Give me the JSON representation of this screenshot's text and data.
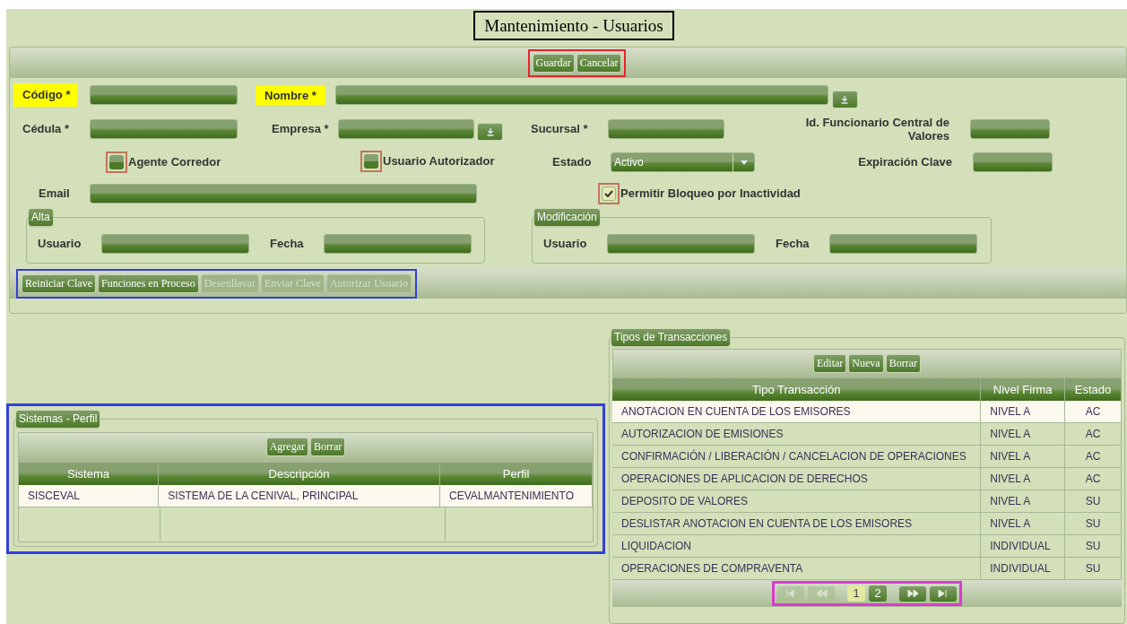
{
  "title": "Mantenimiento - Usuarios",
  "top_buttons": [
    {
      "label": "Guardar",
      "disabled": false
    },
    {
      "label": "Cancelar",
      "disabled": false
    }
  ],
  "fields": {
    "codigo": {
      "label": "Código *",
      "highlighted": true
    },
    "nombre": {
      "label": "Nombre *",
      "highlighted": true
    },
    "cedula": {
      "label": "Cédula *",
      "highlighted": false
    },
    "empresa": {
      "label": "Empresa *",
      "highlighted": false
    },
    "sucursal": {
      "label": "Sucursal *",
      "highlighted": false
    },
    "id_funcionario": {
      "label": "Id. Funcionario Central de Valores",
      "highlighted": false
    },
    "estado": {
      "label": "Estado",
      "value": "Activo",
      "highlighted": false
    },
    "expiracion": {
      "label": "Expiración Clave",
      "highlighted": false
    },
    "email": {
      "label": "Email",
      "highlighted": false
    }
  },
  "checkboxes": [
    {
      "label": "Agente Corredor",
      "checked": false
    },
    {
      "label": "Usuario Autorizador",
      "checked": false
    },
    {
      "label": "Permitir Bloqueo por Inactividad",
      "checked": true
    }
  ],
  "alta": {
    "legend": "Alta",
    "labels": [
      "Usuario",
      "Fecha"
    ]
  },
  "modificacion": {
    "legend": "Modificación",
    "labels": [
      "Usuario",
      "Fecha"
    ]
  },
  "action_buttons": [
    {
      "label": "Reiniciar Clave",
      "disabled": false
    },
    {
      "label": "Funciones en Proceso",
      "disabled": false
    },
    {
      "label": "Desenllavar",
      "disabled": true
    },
    {
      "label": "Enviar Clave",
      "disabled": true
    },
    {
      "label": "Autorizar Usuario",
      "disabled": true
    }
  ],
  "sistemas_perfil": {
    "legend": "Sistemas - Perfil",
    "buttons": [
      "Agregar",
      "Borrar"
    ],
    "columns": [
      "Sistema",
      "Descripción",
      "Perfil"
    ],
    "rows": [
      {
        "cells": [
          "SISCEVAL",
          "SISTEMA DE LA CENIVAL, PRINCIPAL",
          "CEVALMANTENIMIENTO"
        ],
        "selected": true
      }
    ]
  },
  "tipos_transacciones": {
    "legend": "Tipos de Transacciones",
    "buttons": [
      "Editar",
      "Nueva",
      "Borrar"
    ],
    "columns": [
      "Tipo Transacción",
      "Nivel Firma",
      "Estado"
    ],
    "rows": [
      {
        "cells": [
          "ANOTACION EN CUENTA DE LOS EMISORES",
          "NIVEL A",
          "AC"
        ],
        "selected": true
      },
      {
        "cells": [
          "AUTORIZACION DE EMISIONES",
          "NIVEL A",
          "AC"
        ],
        "selected": false
      },
      {
        "cells": [
          "CONFIRMACIÓN / LIBERACIÓN / CANCELACION DE OPERACIONES",
          "NIVEL A",
          "AC"
        ],
        "selected": false
      },
      {
        "cells": [
          "OPERACIONES DE APLICACION DE DERECHOS",
          "NIVEL A",
          "AC"
        ],
        "selected": false
      },
      {
        "cells": [
          "DEPOSITO DE VALORES",
          "NIVEL A",
          "SU"
        ],
        "selected": false
      },
      {
        "cells": [
          "DESLISTAR ANOTACION EN CUENTA DE LOS EMISORES",
          "NIVEL A",
          "SU"
        ],
        "selected": false
      },
      {
        "cells": [
          "LIQUIDACION",
          "INDIVIDUAL",
          "SU"
        ],
        "selected": false
      },
      {
        "cells": [
          "OPERACIONES DE COMPRAVENTA",
          "INDIVIDUAL",
          "SU"
        ],
        "selected": false
      }
    ],
    "pager": {
      "nav": [
        {
          "kind": "first",
          "disabled": true
        },
        {
          "kind": "prev",
          "disabled": true
        },
        {
          "kind": "next",
          "disabled": false
        },
        {
          "kind": "last",
          "disabled": false
        }
      ],
      "pages": [
        {
          "label": "1",
          "selected": true
        },
        {
          "label": "2",
          "selected": false
        }
      ]
    }
  }
}
